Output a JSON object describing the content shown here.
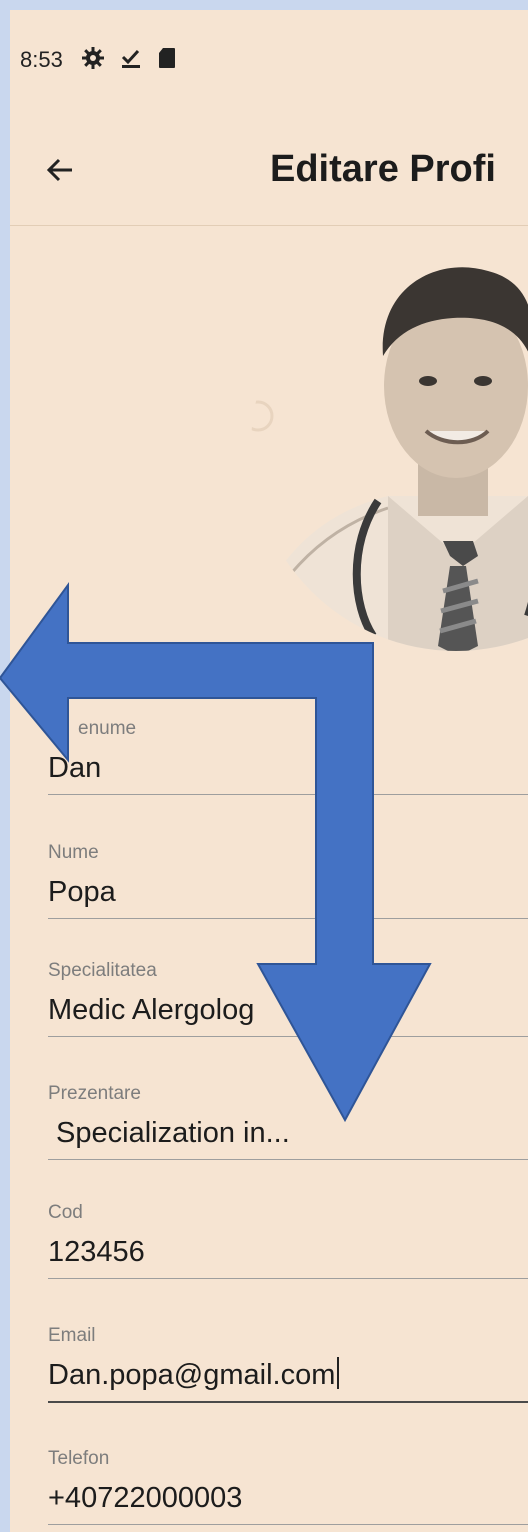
{
  "status_bar": {
    "time": "8:53",
    "icons": [
      "settings-icon",
      "download-done-icon",
      "sd-card-icon"
    ]
  },
  "app_bar": {
    "back_icon": "arrow-back-icon",
    "title": "Editare Profi"
  },
  "avatar": {
    "description_icon": "doctor-photo"
  },
  "form": {
    "fields": [
      {
        "label": "Prenume",
        "label_visible": "enume",
        "value": "Dan"
      },
      {
        "label": "Nume",
        "value": "Popa"
      },
      {
        "label": "Specialitatea",
        "value": "Medic Alergolog"
      },
      {
        "label": "Prezentare",
        "value": " Specialization in..."
      },
      {
        "label": "Cod",
        "value": "123456"
      },
      {
        "label": "Email",
        "value": "Dan.popa@gmail.com"
      },
      {
        "label": "Telefon",
        "value": "+40722000003"
      }
    ]
  },
  "colors": {
    "page_bg": "#c9d7ee",
    "screen_bg": "#f6e4d2",
    "arrow_overlay": "#4472c4"
  }
}
